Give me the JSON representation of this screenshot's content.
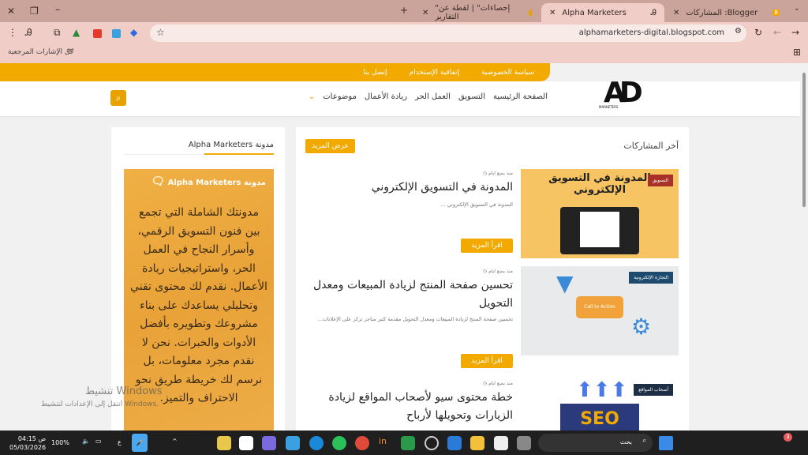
{
  "browser": {
    "tabs": [
      {
        "label": "المشاركات :Blogger",
        "active": false
      },
      {
        "label": "Alpha Marketers",
        "active": true
      },
      {
        "label": "\"إحصاءات\" | لقطة عن التقارير",
        "active": false
      }
    ],
    "url": "alphamarketers-digital.blogspot.com",
    "bookmarks_label": "كل الإشارات المرجعية"
  },
  "site": {
    "top_links": [
      "سياسة الخصوصية",
      "إتفاقية الإستخدام",
      "إتصل بنا"
    ],
    "nav": [
      "الصفحة الرئيسية",
      "التسويق",
      "العمل الحر",
      "ريادة الأعمال",
      "موضوعات"
    ],
    "logo_text": "AD ALPHA MARKETERS مدونة",
    "accent": "#f2a900"
  },
  "main": {
    "section_title": "آخر المشاركات",
    "view_more": "عرض المزيد",
    "read_more": "اقرأ المزيد",
    "posts": [
      {
        "meta": "منذ بضع ايام",
        "title": "المدونة في التسويق الإلكتروني",
        "snippet": "المدونة في التسويق الإلكتروني ...",
        "tag": "التسويق",
        "thumb_text": "المدونة في التسويق الإلكتروني"
      },
      {
        "meta": "منذ بضع ايام",
        "title": "تحسين صفحة المنتج لزيادة المبيعات ومعدل التحويل",
        "snippet": "تحسين صفحة المنتج لزيادة المبيعات ومعدل التحويل مقدمة كثير متاجر تركز على الإعلانات...",
        "tag": "التجارة الإلكترونية",
        "thumb_text": "Call to Action"
      },
      {
        "meta": "منذ بضع ايام",
        "title": "خطة محتوى سيو لأصحاب المواقع لزيادة الزيارات وتحويلها لأرباح",
        "tag": "أصحاب المواقع",
        "thumb_text": "SEO"
      }
    ]
  },
  "sidebar": {
    "title": "مدونة Alpha Marketers",
    "banner_title": "مدونة Alpha Marketers",
    "banner_text": "مدونتك الشاملة التي تجمع بين فنون التسويق الرقمي، وأسرار النجاح في العمل الحر، واستراتيجيات ريادة الأعمال. نقدم لك محتوى تقني وتحليلي يساعدك على بناء مشروعك وتطويره بأفضل الأدوات والخبرات. نحن لا نقدم مجرد معلومات، بل نرسم لك خريطة طريق نحو الاحتراف والتميز."
  },
  "watermark": {
    "line1": "تنشيط Windows",
    "line2": "انتقل إلى الإعدادات لتنشيط Windows."
  },
  "taskbar": {
    "time": "04:15 ص",
    "date": "05/03/2026",
    "battery": "100%",
    "lang": "ع",
    "search": "بحث",
    "notif_count": "3"
  }
}
